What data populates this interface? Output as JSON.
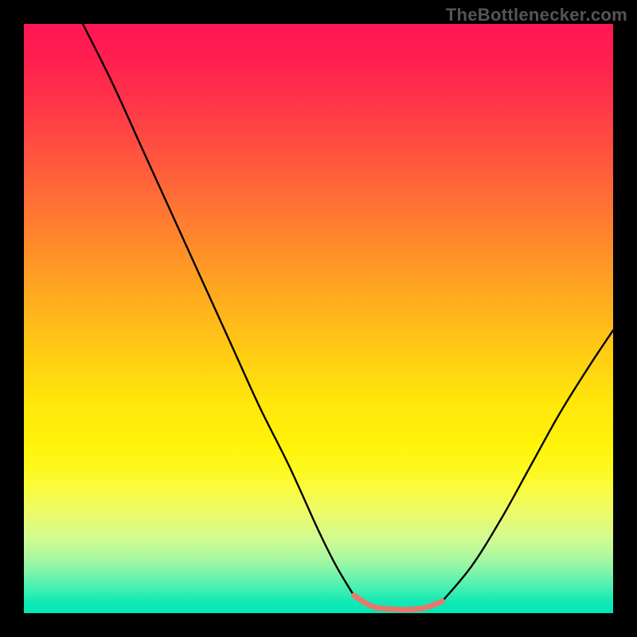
{
  "watermark": "TheBottlenecker.com",
  "colors": {
    "frame": "#000000",
    "curve": "#000000",
    "accent_segment": "#e47a6d"
  },
  "chart_data": {
    "type": "line",
    "title": "",
    "xlabel": "",
    "ylabel": "",
    "xlim": [
      0,
      100
    ],
    "ylim": [
      0,
      100
    ],
    "series": [
      {
        "name": "left-branch",
        "x": [
          10,
          15,
          20,
          25,
          30,
          35,
          40,
          45,
          50,
          53,
          56
        ],
        "values": [
          100,
          90,
          79,
          68,
          57,
          46,
          35,
          25,
          14,
          8,
          3
        ]
      },
      {
        "name": "valley-floor",
        "x": [
          56,
          59,
          62,
          65,
          68,
          71
        ],
        "values": [
          3,
          1.2,
          0.7,
          0.6,
          0.9,
          2.0
        ]
      },
      {
        "name": "right-branch",
        "x": [
          71,
          76,
          81,
          86,
          91,
          96,
          100
        ],
        "values": [
          2.0,
          8,
          16,
          25,
          34,
          42,
          48
        ]
      }
    ],
    "annotations": []
  }
}
